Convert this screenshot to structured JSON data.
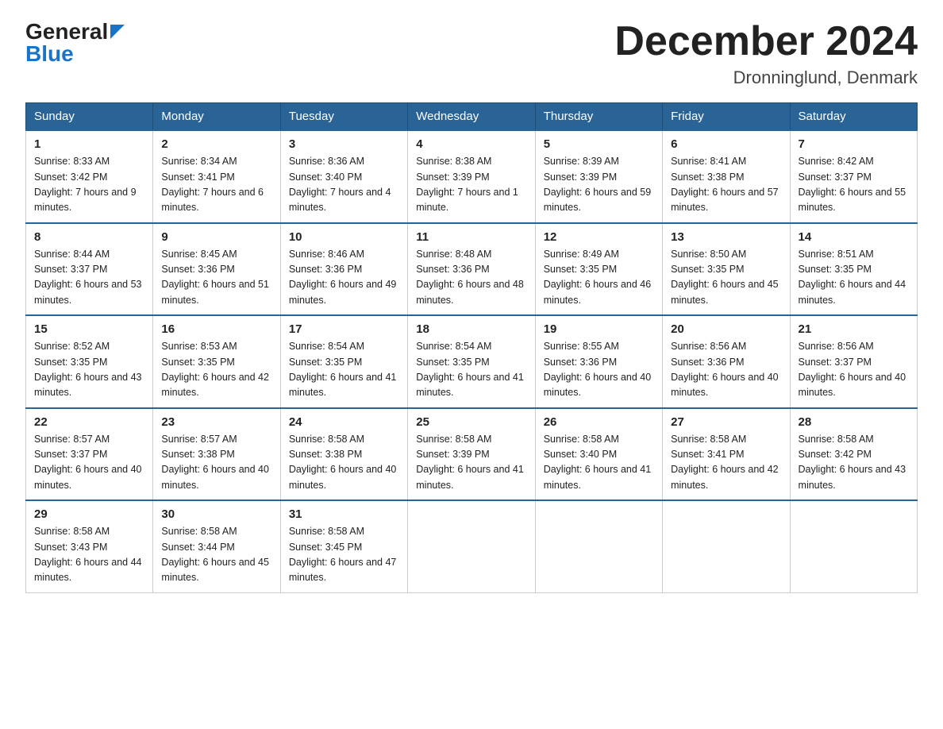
{
  "header": {
    "logo_general": "General",
    "logo_blue": "Blue",
    "month_title": "December 2024",
    "location": "Dronninglund, Denmark"
  },
  "days_of_week": [
    "Sunday",
    "Monday",
    "Tuesday",
    "Wednesday",
    "Thursday",
    "Friday",
    "Saturday"
  ],
  "weeks": [
    [
      {
        "num": "1",
        "sunrise": "8:33 AM",
        "sunset": "3:42 PM",
        "daylight": "7 hours and 9 minutes."
      },
      {
        "num": "2",
        "sunrise": "8:34 AM",
        "sunset": "3:41 PM",
        "daylight": "7 hours and 6 minutes."
      },
      {
        "num": "3",
        "sunrise": "8:36 AM",
        "sunset": "3:40 PM",
        "daylight": "7 hours and 4 minutes."
      },
      {
        "num": "4",
        "sunrise": "8:38 AM",
        "sunset": "3:39 PM",
        "daylight": "7 hours and 1 minute."
      },
      {
        "num": "5",
        "sunrise": "8:39 AM",
        "sunset": "3:39 PM",
        "daylight": "6 hours and 59 minutes."
      },
      {
        "num": "6",
        "sunrise": "8:41 AM",
        "sunset": "3:38 PM",
        "daylight": "6 hours and 57 minutes."
      },
      {
        "num": "7",
        "sunrise": "8:42 AM",
        "sunset": "3:37 PM",
        "daylight": "6 hours and 55 minutes."
      }
    ],
    [
      {
        "num": "8",
        "sunrise": "8:44 AM",
        "sunset": "3:37 PM",
        "daylight": "6 hours and 53 minutes."
      },
      {
        "num": "9",
        "sunrise": "8:45 AM",
        "sunset": "3:36 PM",
        "daylight": "6 hours and 51 minutes."
      },
      {
        "num": "10",
        "sunrise": "8:46 AM",
        "sunset": "3:36 PM",
        "daylight": "6 hours and 49 minutes."
      },
      {
        "num": "11",
        "sunrise": "8:48 AM",
        "sunset": "3:36 PM",
        "daylight": "6 hours and 48 minutes."
      },
      {
        "num": "12",
        "sunrise": "8:49 AM",
        "sunset": "3:35 PM",
        "daylight": "6 hours and 46 minutes."
      },
      {
        "num": "13",
        "sunrise": "8:50 AM",
        "sunset": "3:35 PM",
        "daylight": "6 hours and 45 minutes."
      },
      {
        "num": "14",
        "sunrise": "8:51 AM",
        "sunset": "3:35 PM",
        "daylight": "6 hours and 44 minutes."
      }
    ],
    [
      {
        "num": "15",
        "sunrise": "8:52 AM",
        "sunset": "3:35 PM",
        "daylight": "6 hours and 43 minutes."
      },
      {
        "num": "16",
        "sunrise": "8:53 AM",
        "sunset": "3:35 PM",
        "daylight": "6 hours and 42 minutes."
      },
      {
        "num": "17",
        "sunrise": "8:54 AM",
        "sunset": "3:35 PM",
        "daylight": "6 hours and 41 minutes."
      },
      {
        "num": "18",
        "sunrise": "8:54 AM",
        "sunset": "3:35 PM",
        "daylight": "6 hours and 41 minutes."
      },
      {
        "num": "19",
        "sunrise": "8:55 AM",
        "sunset": "3:36 PM",
        "daylight": "6 hours and 40 minutes."
      },
      {
        "num": "20",
        "sunrise": "8:56 AM",
        "sunset": "3:36 PM",
        "daylight": "6 hours and 40 minutes."
      },
      {
        "num": "21",
        "sunrise": "8:56 AM",
        "sunset": "3:37 PM",
        "daylight": "6 hours and 40 minutes."
      }
    ],
    [
      {
        "num": "22",
        "sunrise": "8:57 AM",
        "sunset": "3:37 PM",
        "daylight": "6 hours and 40 minutes."
      },
      {
        "num": "23",
        "sunrise": "8:57 AM",
        "sunset": "3:38 PM",
        "daylight": "6 hours and 40 minutes."
      },
      {
        "num": "24",
        "sunrise": "8:58 AM",
        "sunset": "3:38 PM",
        "daylight": "6 hours and 40 minutes."
      },
      {
        "num": "25",
        "sunrise": "8:58 AM",
        "sunset": "3:39 PM",
        "daylight": "6 hours and 41 minutes."
      },
      {
        "num": "26",
        "sunrise": "8:58 AM",
        "sunset": "3:40 PM",
        "daylight": "6 hours and 41 minutes."
      },
      {
        "num": "27",
        "sunrise": "8:58 AM",
        "sunset": "3:41 PM",
        "daylight": "6 hours and 42 minutes."
      },
      {
        "num": "28",
        "sunrise": "8:58 AM",
        "sunset": "3:42 PM",
        "daylight": "6 hours and 43 minutes."
      }
    ],
    [
      {
        "num": "29",
        "sunrise": "8:58 AM",
        "sunset": "3:43 PM",
        "daylight": "6 hours and 44 minutes."
      },
      {
        "num": "30",
        "sunrise": "8:58 AM",
        "sunset": "3:44 PM",
        "daylight": "6 hours and 45 minutes."
      },
      {
        "num": "31",
        "sunrise": "8:58 AM",
        "sunset": "3:45 PM",
        "daylight": "6 hours and 47 minutes."
      },
      null,
      null,
      null,
      null
    ]
  ],
  "labels": {
    "sunrise": "Sunrise:",
    "sunset": "Sunset:",
    "daylight": "Daylight:"
  }
}
